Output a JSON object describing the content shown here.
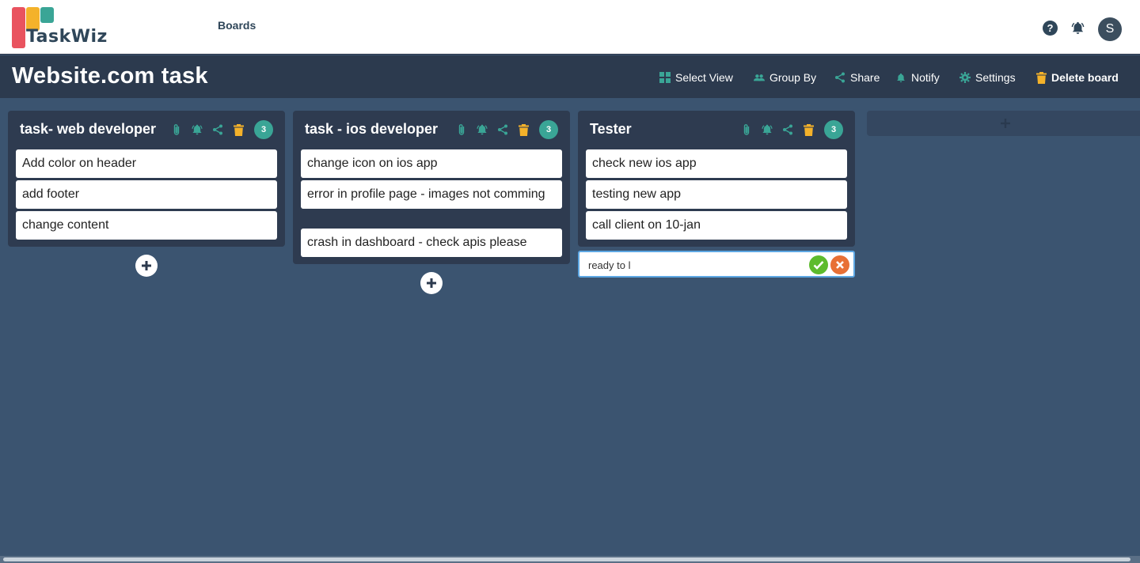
{
  "app": {
    "logo_text": "TaskWiz",
    "nav_boards": "Boards",
    "help": "?",
    "avatar_initial": "S"
  },
  "board": {
    "title": "Website.com task",
    "toolbar": {
      "select_view": "Select View",
      "group_by": "Group By",
      "share": "Share",
      "notify": "Notify",
      "settings": "Settings",
      "delete_board": "Delete board"
    }
  },
  "lists": [
    {
      "title": "task- web developer",
      "count": "3",
      "cards": [
        "Add color on header",
        "add footer",
        "change content"
      ]
    },
    {
      "title": "task - ios developer",
      "count": "3",
      "cards": [
        "change icon on ios app",
        "error in profile page - images not comming",
        "crash in dashboard - check apis please"
      ]
    },
    {
      "title": "Tester",
      "count": "3",
      "cards": [
        "check new ios app",
        "testing new app",
        "call client on 10-jan"
      ]
    }
  ],
  "new_card": {
    "value": "ready to l"
  },
  "colors": {
    "teal": "#3aa596",
    "yellow": "#f4b22a",
    "red": "#e9535f",
    "board_bg": "#3b5470",
    "list_bg": "#2e3b50",
    "confirm": "#5dbb2d",
    "cancel": "#e87035"
  }
}
